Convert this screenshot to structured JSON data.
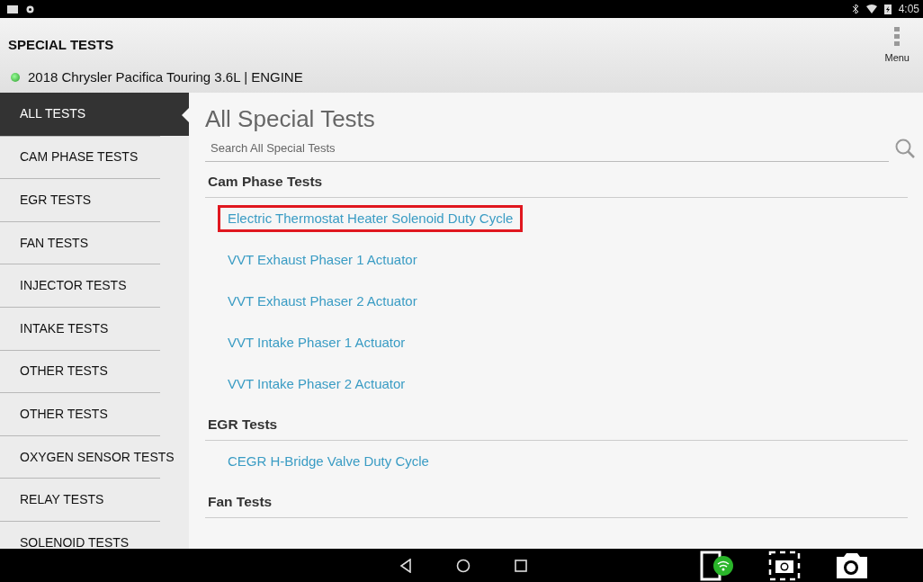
{
  "status_bar": {
    "time": "4:05"
  },
  "header": {
    "title": "SPECIAL TESTS",
    "vehicle": "2018 Chrysler Pacifica Touring 3.6L | ENGINE",
    "connected": true,
    "menu_label": "Menu"
  },
  "sidebar": {
    "items": [
      {
        "label": "ALL TESTS",
        "selected": true
      },
      {
        "label": "CAM PHASE TESTS",
        "selected": false
      },
      {
        "label": "EGR TESTS",
        "selected": false
      },
      {
        "label": "FAN TESTS",
        "selected": false
      },
      {
        "label": "INJECTOR TESTS",
        "selected": false
      },
      {
        "label": "INTAKE TESTS",
        "selected": false
      },
      {
        "label": "OTHER TESTS",
        "selected": false
      },
      {
        "label": "OTHER TESTS",
        "selected": false
      },
      {
        "label": "OXYGEN SENSOR TESTS",
        "selected": false
      },
      {
        "label": "RELAY TESTS",
        "selected": false
      },
      {
        "label": "SOLENOID TESTS",
        "selected": false
      }
    ]
  },
  "content": {
    "title": "All Special Tests",
    "search": {
      "placeholder": "Search All Special Tests"
    },
    "sections": [
      {
        "heading": "Cam Phase Tests",
        "tests": [
          {
            "label": "Electric Thermostat Heater Solenoid Duty Cycle",
            "highlighted": true
          },
          {
            "label": "VVT Exhaust Phaser 1 Actuator",
            "highlighted": false
          },
          {
            "label": "VVT Exhaust Phaser 2 Actuator",
            "highlighted": false
          },
          {
            "label": "VVT Intake Phaser 1 Actuator",
            "highlighted": false
          },
          {
            "label": "VVT Intake Phaser 2 Actuator",
            "highlighted": false
          }
        ]
      },
      {
        "heading": "EGR Tests",
        "tests": [
          {
            "label": "CEGR H-Bridge Valve Duty Cycle",
            "highlighted": false
          }
        ]
      },
      {
        "heading": "Fan Tests"
      }
    ]
  }
}
